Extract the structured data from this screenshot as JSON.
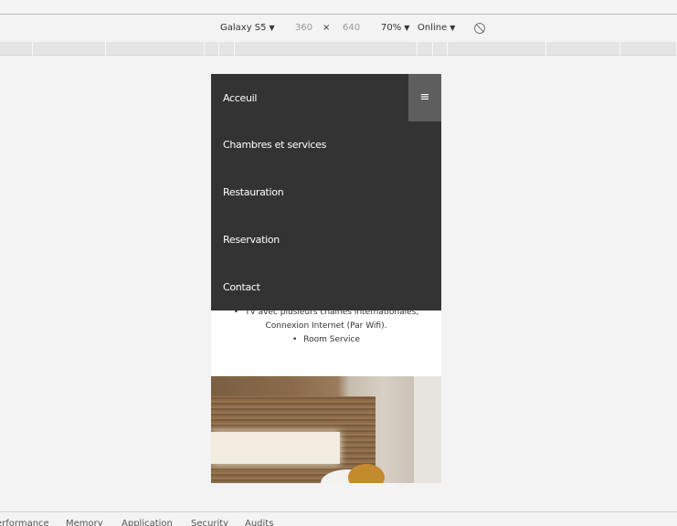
{
  "toolbar": {
    "device": "Galaxy S5",
    "width": "360",
    "times": "×",
    "height": "640",
    "zoom": "70%",
    "network": "Online",
    "caret": "▼",
    "no_throttle_icon": "no-throttling-icon"
  },
  "nav": {
    "items": [
      "Acceuil",
      "Chambres et services",
      "Restauration",
      "Reservation",
      "Contact"
    ],
    "menu_icon": "≡",
    "background": "#333333",
    "toggle_background": "#5e5e5e"
  },
  "content": {
    "list": [
      "TV avec plusieurs chaines internationales,",
      "Connexion Internet (Par Wifi).",
      "Room Service"
    ]
  },
  "bottom_tabs": [
    "erformance",
    "Memory",
    "Application",
    "Security",
    "Audits"
  ]
}
